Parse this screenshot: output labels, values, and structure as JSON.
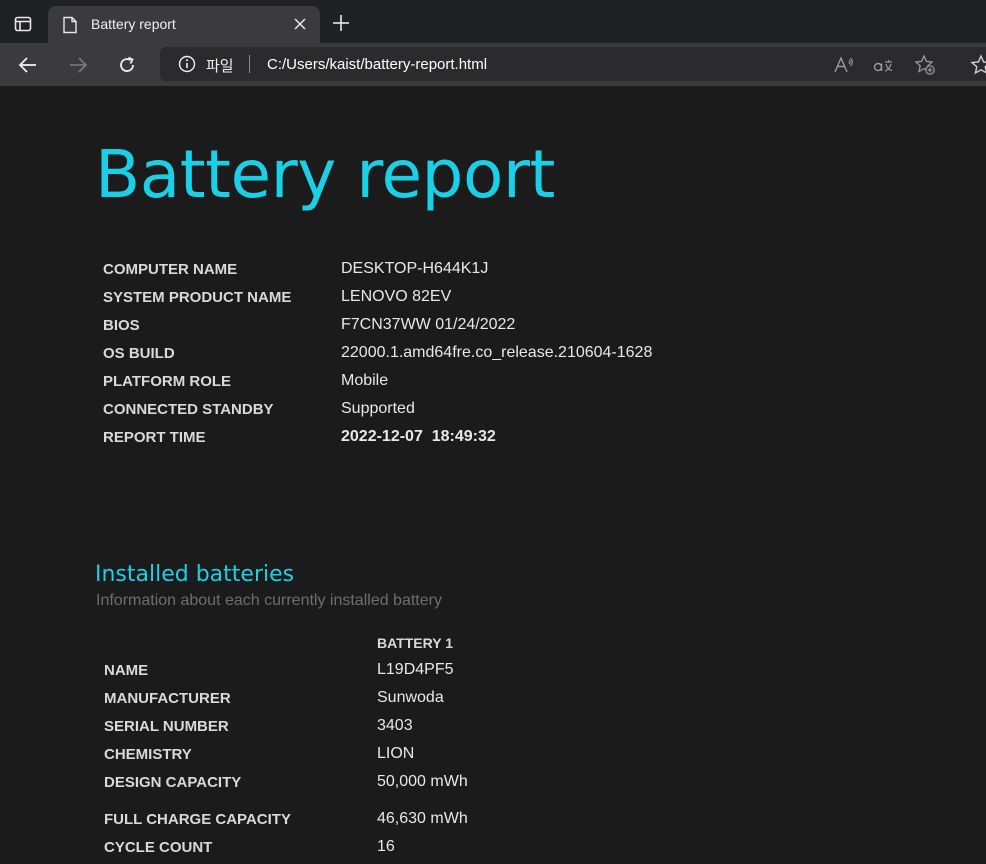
{
  "browser": {
    "tab_title": "Battery report",
    "protocol_label": "파일",
    "url": "C:/Users/kaist/battery-report.html"
  },
  "report": {
    "title": "Battery report",
    "system_info": [
      {
        "label": "COMPUTER NAME",
        "value": "DESKTOP-H644K1J"
      },
      {
        "label": "SYSTEM PRODUCT NAME",
        "value": "LENOVO 82EV"
      },
      {
        "label": "BIOS",
        "value": "F7CN37WW 01/24/2022"
      },
      {
        "label": "OS BUILD",
        "value": "22000.1.amd64fre.co_release.210604-1628"
      },
      {
        "label": "PLATFORM ROLE",
        "value": "Mobile"
      },
      {
        "label": "CONNECTED STANDBY",
        "value": "Supported"
      },
      {
        "label": "REPORT TIME",
        "value": "2022-12-07  18:49:32"
      }
    ]
  },
  "installed_batteries": {
    "title": "Installed batteries",
    "subtitle": "Information about each currently installed battery",
    "column_header": "BATTERY 1",
    "rows": [
      {
        "label": "NAME",
        "value": "L19D4PF5"
      },
      {
        "label": "MANUFACTURER",
        "value": "Sunwoda"
      },
      {
        "label": "SERIAL NUMBER",
        "value": "3403"
      },
      {
        "label": "CHEMISTRY",
        "value": "LION"
      },
      {
        "label": "DESIGN CAPACITY",
        "value": "50,000 mWh"
      },
      {
        "label": "FULL CHARGE CAPACITY",
        "value": "46,630 mWh"
      },
      {
        "label": "CYCLE COUNT",
        "value": "16"
      }
    ]
  },
  "colors": {
    "accent": "#1ad0e6",
    "background": "#1b1b1c",
    "chrome": "#3b3b3d"
  }
}
